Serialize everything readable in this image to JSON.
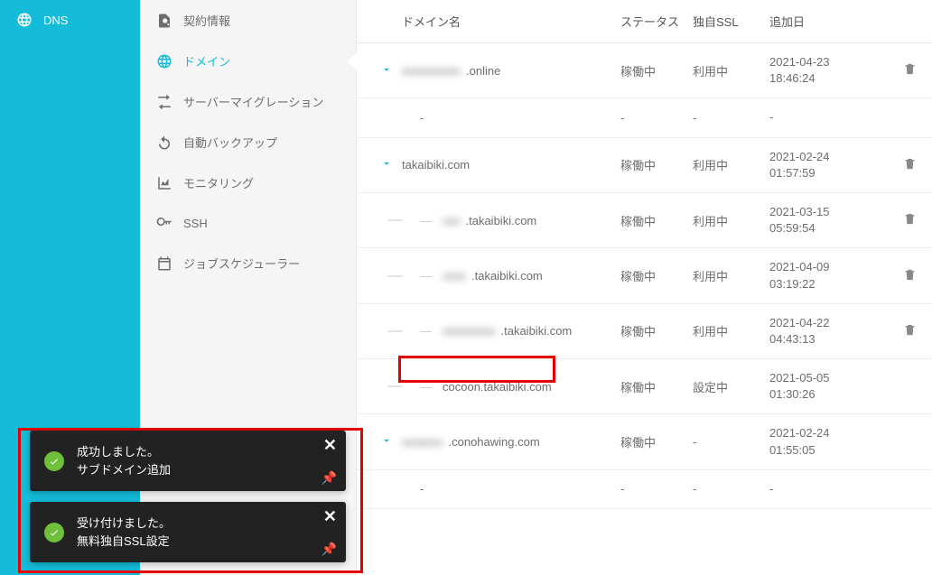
{
  "left_nav": {
    "dns_label": "DNS"
  },
  "sub_nav": {
    "items": [
      "契約情報",
      "ドメイン",
      "サーバーマイグレーション",
      "自動バックアップ",
      "モニタリング",
      "SSH",
      "ジョブスケジューラー"
    ]
  },
  "headers": {
    "domain": "ドメイン名",
    "status": "ステータス",
    "ssl": "独自SSL",
    "date": "追加日"
  },
  "running": "稼働中",
  "in_use": "利用中",
  "setting": "設定中",
  "rows": [
    {
      "type": "main",
      "blur_prefix": "xxxxxxxxxx",
      "domain_suffix": ".online",
      "status": "稼働中",
      "ssl": "利用中",
      "date_l1": "2021-04-23",
      "date_l2": "18:46:24",
      "has_del": true
    },
    {
      "type": "sub",
      "domain": "-",
      "status": "-",
      "ssl": "-",
      "date_l1": "-",
      "date_l2": "",
      "has_del": false,
      "plain_dash": true
    },
    {
      "type": "main",
      "blur_prefix": "",
      "domain_suffix": "takaibiki.com",
      "status": "稼働中",
      "ssl": "利用中",
      "date_l1": "2021-02-24",
      "date_l2": "01:57:59",
      "has_del": true
    },
    {
      "type": "sub",
      "blur_prefix": "xxx",
      "domain_suffix": ".takaibiki.com",
      "status": "稼働中",
      "ssl": "利用中",
      "date_l1": "2021-03-15",
      "date_l2": "05:59:54",
      "has_del": true
    },
    {
      "type": "sub",
      "blur_prefix": "xxxx",
      "domain_suffix": ".takaibiki.com",
      "status": "稼働中",
      "ssl": "利用中",
      "date_l1": "2021-04-09",
      "date_l2": "03:19:22",
      "has_del": true
    },
    {
      "type": "sub",
      "blur_prefix": "xxxxxxxxx",
      "domain_suffix": ".takaibiki.com",
      "status": "稼働中",
      "ssl": "利用中",
      "date_l1": "2021-04-22",
      "date_l2": "04:43:13",
      "has_del": true
    },
    {
      "type": "sub",
      "blur_prefix": "",
      "domain_suffix": "cocoon.takaibiki.com",
      "status": "稼働中",
      "ssl": "設定中",
      "date_l1": "2021-05-05",
      "date_l2": "01:30:26",
      "has_del": false,
      "highlighted": true
    },
    {
      "type": "main",
      "blur_prefix": "xxxxxxx",
      "domain_suffix": ".conohawing.com",
      "status": "稼働中",
      "ssl": "-",
      "date_l1": "2021-02-24",
      "date_l2": "01:55:05",
      "has_del": false
    },
    {
      "type": "sub",
      "domain": "-",
      "status": "-",
      "ssl": "-",
      "date_l1": "-",
      "date_l2": "",
      "has_del": false,
      "plain_dash": true
    }
  ],
  "toasts": [
    {
      "line1": "成功しました。",
      "line2": "サブドメイン追加"
    },
    {
      "line1": "受け付けました。",
      "line2": "無料独自SSL設定"
    }
  ]
}
